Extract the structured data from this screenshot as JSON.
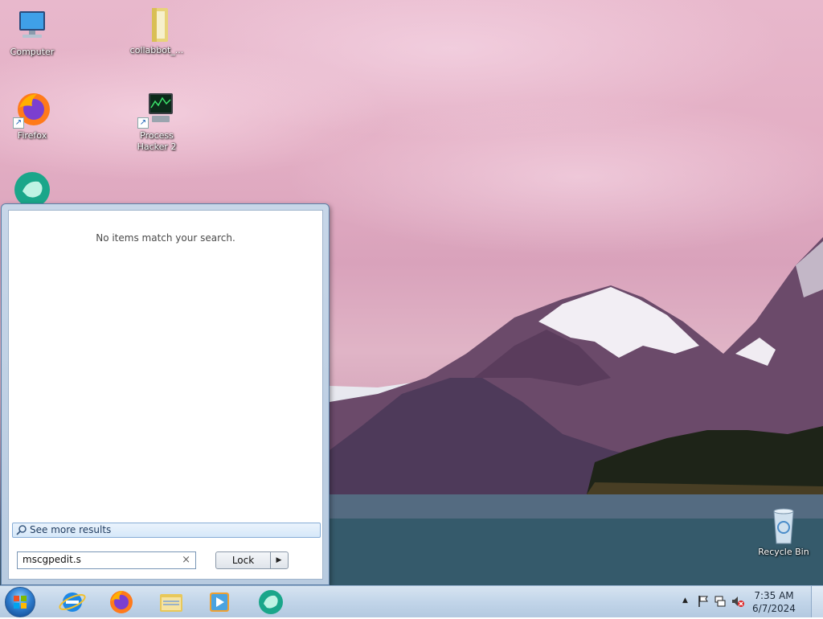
{
  "desktop": {
    "icons": [
      {
        "label": "Computer",
        "icon": "computer-icon"
      },
      {
        "label": "collabbot_...",
        "icon": "folder-icon"
      },
      {
        "label": "Firefox",
        "icon": "firefox-icon"
      },
      {
        "label": "Process Hacker 2",
        "icon": "process-hacker-icon"
      },
      {
        "label": "",
        "icon": "app-icon"
      },
      {
        "label": "Recycle Bin",
        "icon": "recycle-bin-icon"
      }
    ]
  },
  "start_menu": {
    "no_results_text": "No items match your search.",
    "see_more_label": "See more results",
    "search_value": "mscgpedit.s",
    "clear_glyph": "×",
    "lock_label": "Lock",
    "lock_arrow": "▶"
  },
  "taskbar": {
    "pinned": [
      "start-orb",
      "internet-explorer-icon",
      "firefox-icon",
      "file-explorer-icon",
      "media-player-icon",
      "app-icon"
    ],
    "tray_icons": [
      "show-hidden-icons-arrow",
      "action-center-flag-icon",
      "network-icon",
      "volume-muted-icon"
    ],
    "time": "7:35 AM",
    "date": "6/7/2024"
  },
  "colors": {
    "accent": "#2f7fd0",
    "taskbar": "#c2d5e9",
    "start_menu_frame": "#b8cbe0"
  }
}
